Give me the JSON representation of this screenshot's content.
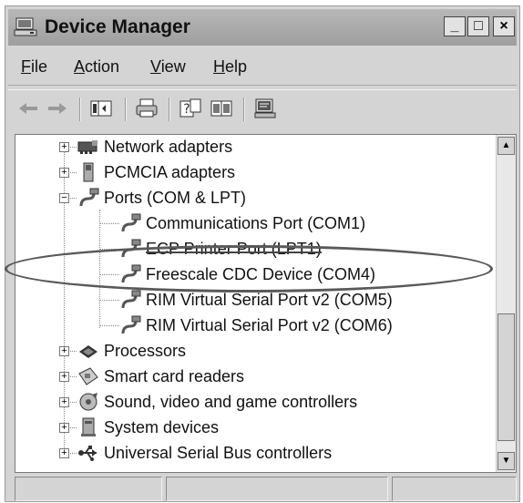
{
  "window": {
    "title": "Device Manager",
    "controls": {
      "minimize": "_",
      "maximize": "□",
      "close": "×"
    }
  },
  "menu": {
    "items": [
      {
        "label": "File",
        "accel": "F",
        "rest": "ile"
      },
      {
        "label": "Action",
        "accel": "A",
        "rest": "ction"
      },
      {
        "label": "View",
        "accel": "V",
        "rest": "iew"
      },
      {
        "label": "Help",
        "accel": "H",
        "rest": "elp"
      }
    ]
  },
  "toolbar": {
    "buttons": [
      "back-arrow-icon",
      "forward-arrow-icon",
      "show-hide-tree-icon",
      "print-icon",
      "help-icon",
      "properties-icon",
      "scan-hardware-icon"
    ]
  },
  "tree": {
    "nodes": [
      {
        "label": "Network adapters",
        "icon": "network-adapter-icon"
      },
      {
        "label": "PCMCIA adapters",
        "icon": "pcmcia-icon"
      },
      {
        "label": "Ports (COM & LPT)",
        "icon": "port-icon"
      },
      {
        "label": "Communications Port (COM1)",
        "icon": "port-icon"
      },
      {
        "label": "ECP Printer Port (LPT1)",
        "icon": "port-icon"
      },
      {
        "label": "Freescale CDC Device (COM4)",
        "icon": "port-icon"
      },
      {
        "label": "RIM Virtual Serial Port v2 (COM5)",
        "icon": "port-icon"
      },
      {
        "label": "RIM Virtual Serial Port v2 (COM6)",
        "icon": "port-icon"
      },
      {
        "label": "Processors",
        "icon": "processor-icon"
      },
      {
        "label": "Smart card readers",
        "icon": "smart-card-icon"
      },
      {
        "label": "Sound, video and game controllers",
        "icon": "sound-icon"
      },
      {
        "label": "System devices",
        "icon": "system-devices-icon"
      },
      {
        "label": "Universal Serial Bus controllers",
        "icon": "usb-icon"
      }
    ],
    "expanders": {
      "collapsed": "+",
      "expanded": "−"
    },
    "highlighted": "Freescale CDC Device (COM4)"
  },
  "scrollbar": {
    "up": "▲",
    "down": "▼"
  },
  "colors": {
    "highlight_ring": "#595959",
    "window_bg": "#d4d4d4"
  }
}
